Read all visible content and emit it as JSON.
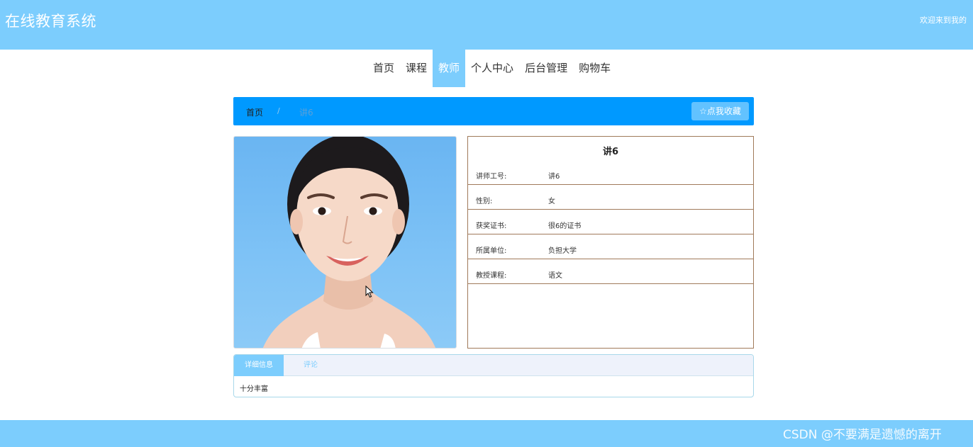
{
  "header": {
    "site_title": "在线教育系统",
    "welcome_text": "欢迎来到我的"
  },
  "nav": {
    "items": [
      {
        "label": "首页",
        "active": false
      },
      {
        "label": "课程",
        "active": false
      },
      {
        "label": "教师",
        "active": true
      },
      {
        "label": "个人中心",
        "active": false
      },
      {
        "label": "后台管理",
        "active": false
      },
      {
        "label": "购物车",
        "active": false
      }
    ]
  },
  "breadcrumb": {
    "home": "首页",
    "separator": "/",
    "current": "讲6"
  },
  "favorite_button": {
    "icon": "star-icon",
    "label": "☆点我收藏"
  },
  "photo": {
    "icon": "teacher-portrait-photo"
  },
  "teacher": {
    "name": "讲6",
    "fields": [
      {
        "label": "讲师工号:",
        "value": "讲6"
      },
      {
        "label": "性别:",
        "value": "女"
      },
      {
        "label": "获奖证书:",
        "value": "很6的证书"
      },
      {
        "label": "所属单位:",
        "value": "负担大学"
      },
      {
        "label": "教授课程:",
        "value": "语文"
      }
    ]
  },
  "tabs": {
    "items": [
      {
        "label": "详细信息",
        "active": true
      },
      {
        "label": "评论",
        "active": false
      }
    ],
    "content": "十分丰富"
  },
  "footer": {
    "watermark": "CSDN @不要满是遗憾的离开"
  },
  "colors": {
    "header_bg": "#7ccdfd",
    "breadcrumb_bg": "#0099ff",
    "info_border": "#a07a5a"
  }
}
